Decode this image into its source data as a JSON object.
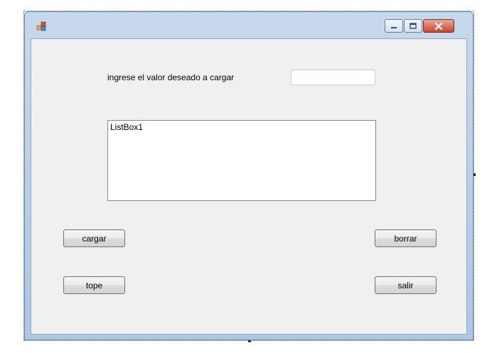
{
  "window": {
    "title": "",
    "controls": {
      "minimize": "minimize-icon",
      "maximize": "maximize-icon",
      "close": "close-icon"
    }
  },
  "form": {
    "prompt_label": "ingrese el valor deseado a cargar",
    "value_input": {
      "value": "",
      "placeholder": ""
    },
    "listbox": {
      "items": [
        "ListBox1"
      ]
    },
    "buttons": {
      "cargar": "cargar",
      "borrar": "borrar",
      "tope": "tope",
      "salir": "salir"
    }
  },
  "colors": {
    "titlebar": "#c7d8ec",
    "client_bg": "#f0f0f0",
    "close_button": "#c9452e"
  }
}
